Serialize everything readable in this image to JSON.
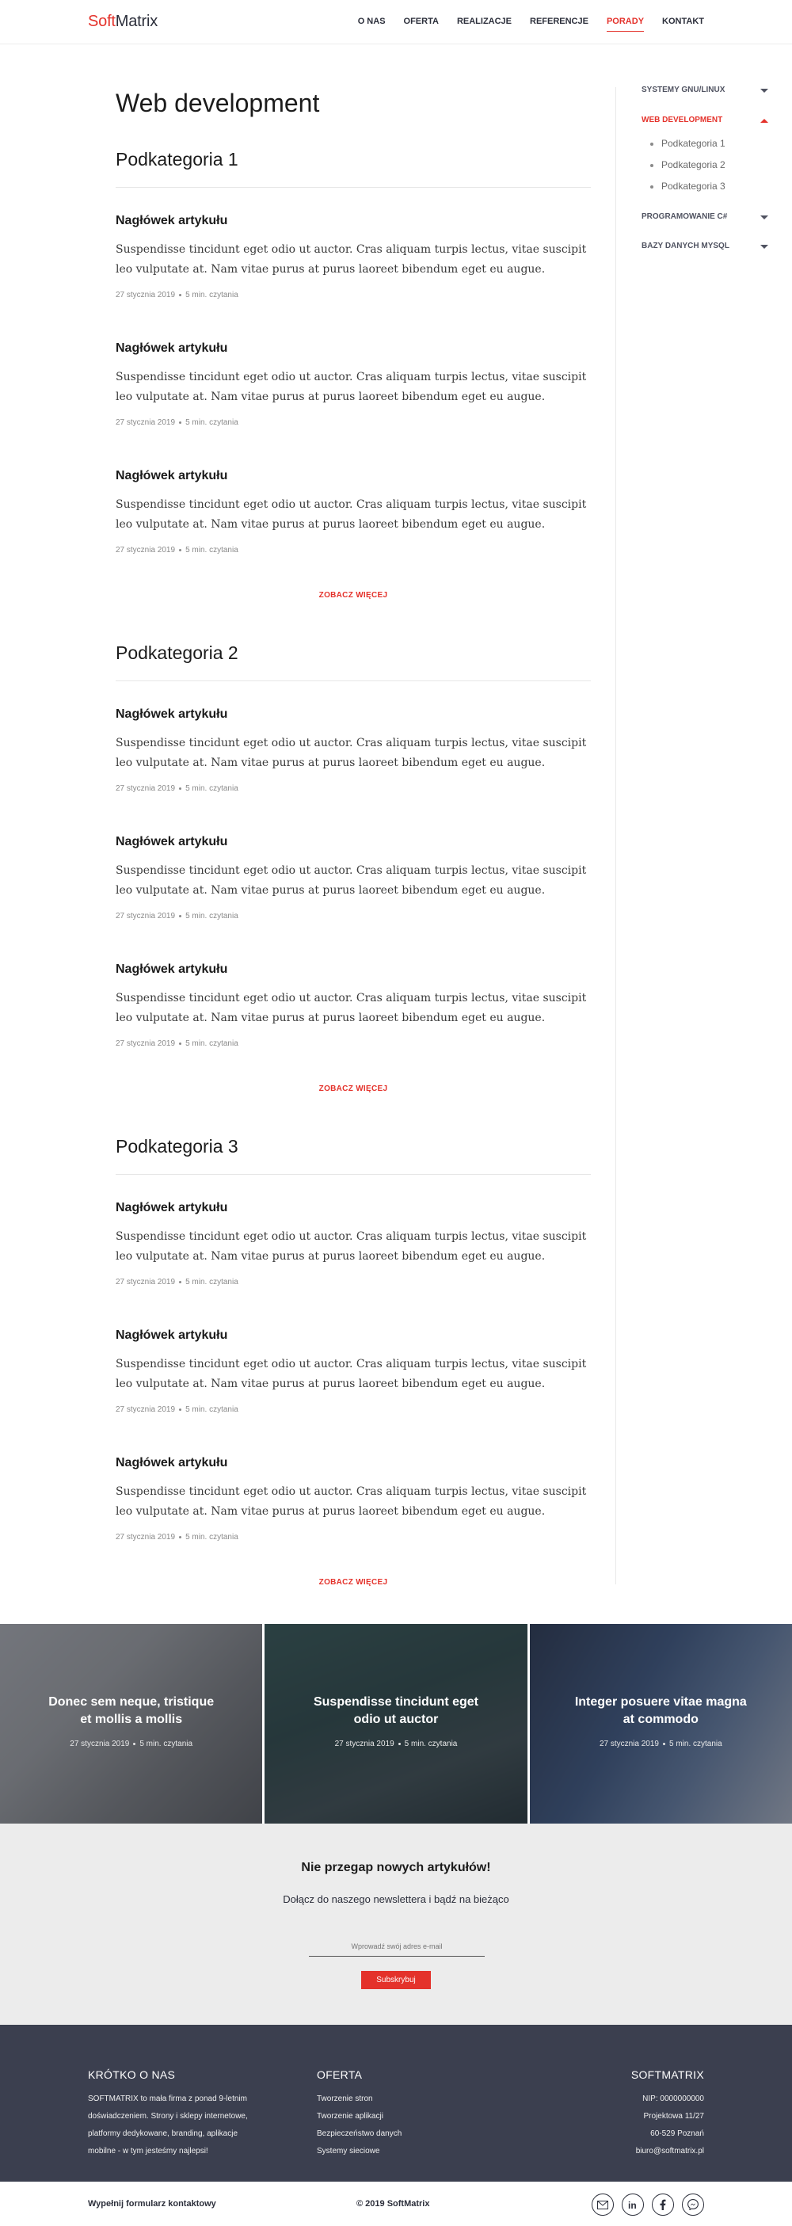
{
  "brand": {
    "part1": "Soft",
    "part2": "Matrix"
  },
  "nav": [
    "O NAS",
    "OFERTA",
    "REALIZACJE",
    "REFERENCJE",
    "PORADY",
    "KONTAKT"
  ],
  "page_title": "Web development",
  "subcategories": [
    {
      "title": "Podkategoria 1",
      "articles": [
        {
          "title": "Nagłówek artykułu",
          "text": "Suspendisse tincidunt eget odio ut auctor. Cras aliquam turpis lectus, vitae suscipit leo vulputate at. Nam vitae purus at purus laoreet bibendum eget eu augue.",
          "date": "27 stycznia 2019",
          "read": "5 min. czytania"
        },
        {
          "title": "Nagłówek artykułu",
          "text": "Suspendisse tincidunt eget odio ut auctor. Cras aliquam turpis lectus, vitae suscipit leo vulputate at. Nam vitae purus at purus laoreet bibendum eget eu augue.",
          "date": "27 stycznia 2019",
          "read": "5 min. czytania"
        },
        {
          "title": "Nagłówek artykułu",
          "text": "Suspendisse tincidunt eget odio ut auctor. Cras aliquam turpis lectus, vitae suscipit leo vulputate at. Nam vitae purus at purus laoreet bibendum eget eu augue.",
          "date": "27 stycznia 2019",
          "read": "5 min. czytania"
        }
      ],
      "more": "ZOBACZ WIĘCEJ"
    },
    {
      "title": "Podkategoria 2",
      "articles": [
        {
          "title": "Nagłówek artykułu",
          "text": "Suspendisse tincidunt eget odio ut auctor. Cras aliquam turpis lectus, vitae suscipit leo vulputate at. Nam vitae purus at purus laoreet bibendum eget eu augue.",
          "date": "27 stycznia 2019",
          "read": "5 min. czytania"
        },
        {
          "title": "Nagłówek artykułu",
          "text": "Suspendisse tincidunt eget odio ut auctor. Cras aliquam turpis lectus, vitae suscipit leo vulputate at. Nam vitae purus at purus laoreet bibendum eget eu augue.",
          "date": "27 stycznia 2019",
          "read": "5 min. czytania"
        },
        {
          "title": "Nagłówek artykułu",
          "text": "Suspendisse tincidunt eget odio ut auctor. Cras aliquam turpis lectus, vitae suscipit leo vulputate at. Nam vitae purus at purus laoreet bibendum eget eu augue.",
          "date": "27 stycznia 2019",
          "read": "5 min. czytania"
        }
      ],
      "more": "ZOBACZ WIĘCEJ"
    },
    {
      "title": "Podkategoria 3",
      "articles": [
        {
          "title": "Nagłówek artykułu",
          "text": "Suspendisse tincidunt eget odio ut auctor. Cras aliquam turpis lectus, vitae suscipit leo vulputate at. Nam vitae purus at purus laoreet bibendum eget eu augue.",
          "date": "27 stycznia 2019",
          "read": "5 min. czytania"
        },
        {
          "title": "Nagłówek artykułu",
          "text": "Suspendisse tincidunt eget odio ut auctor. Cras aliquam turpis lectus, vitae suscipit leo vulputate at. Nam vitae purus at purus laoreet bibendum eget eu augue.",
          "date": "27 stycznia 2019",
          "read": "5 min. czytania"
        },
        {
          "title": "Nagłówek artykułu",
          "text": "Suspendisse tincidunt eget odio ut auctor. Cras aliquam turpis lectus, vitae suscipit leo vulputate at. Nam vitae purus at purus laoreet bibendum eget eu augue.",
          "date": "27 stycznia 2019",
          "read": "5 min. czytania"
        }
      ],
      "more": "ZOBACZ WIĘCEJ"
    }
  ],
  "sidebar": {
    "categories": [
      {
        "label": "SYSTEMY GNU/LINUX",
        "open": false
      },
      {
        "label": "WEB DEVELOPMENT",
        "open": true,
        "items": [
          "Podkategoria 1",
          "Podkategoria 2",
          "Podkategoria 3"
        ]
      },
      {
        "label": "PROGRAMOWANIE C#",
        "open": false
      },
      {
        "label": "BAZY DANYCH MYSQL",
        "open": false
      }
    ]
  },
  "featured": [
    {
      "title": "Donec sem neque, tristique et mollis a mollis",
      "date": "27 stycznia 2019",
      "read": "5 min. czytania"
    },
    {
      "title": "Suspendisse tincidunt eget odio ut auctor",
      "date": "27 stycznia 2019",
      "read": "5 min. czytania"
    },
    {
      "title": "Integer posuere vitae magna at commodo",
      "date": "27 stycznia 2019",
      "read": "5 min. czytania"
    }
  ],
  "newsletter": {
    "title": "Nie przegap nowych artykułów!",
    "lead": "Dołącz do naszego newslettera i bądź na bieżąco",
    "placeholder": "Wprowadź swój adres e-mail",
    "button": "Subskrybuj"
  },
  "footer": {
    "about_title": "KRÓTKO O NAS",
    "about_lines": [
      "SOFTMATRIX to mała firma z ponad 9-letnim",
      "doświadczeniem. Strony i sklepy internetowe,",
      "platformy dedykowane, branding, aplikacje",
      "mobilne - w tym jesteśmy najlepsi!"
    ],
    "offer_title": "OFERTA",
    "offer_items": [
      "Tworzenie stron",
      "Tworzenie aplikacji",
      "Bezpieczeństwo danych",
      "Systemy sieciowe"
    ],
    "company_title": "SOFTMATRIX",
    "company_lines": [
      "NIP: 0000000000",
      "Projektowa 11/27",
      "60-529 Poznań",
      "biuro@softmatrix.pl"
    ]
  },
  "bottom": {
    "contact_link": "Wypełnij formularz kontaktowy",
    "copyright": "© 2019 SoftMatrix"
  },
  "social_icons": [
    "mail-icon",
    "linkedin-icon",
    "facebook-icon",
    "messenger-icon"
  ],
  "colors": {
    "accent": "#e4322b",
    "dark": "#3b3f4f",
    "newsletter_bg": "#ececec"
  }
}
